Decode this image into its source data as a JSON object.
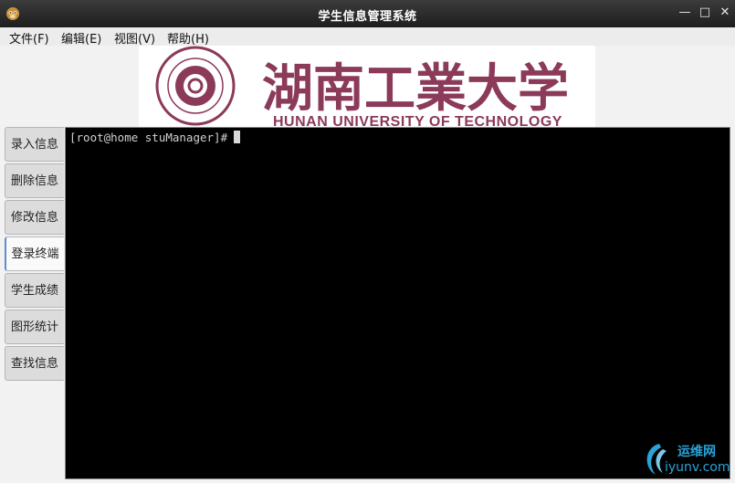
{
  "window": {
    "title": "学生信息管理系统",
    "icon": "monkey-app-icon"
  },
  "window_controls": {
    "minimize": "—",
    "maximize": "□",
    "close": "✕"
  },
  "menu": [
    "文件(F)",
    "编辑(E)",
    "视图(V)",
    "帮助(H)"
  ],
  "logo": {
    "cn": "湖南工業大学",
    "en": "HUNAN UNIVERSITY OF TECHNOLOGY"
  },
  "tabs": [
    {
      "label": "录入信息",
      "active": false
    },
    {
      "label": "删除信息",
      "active": false
    },
    {
      "label": "修改信息",
      "active": false
    },
    {
      "label": "登录终端",
      "active": true
    },
    {
      "label": "学生成绩",
      "active": false
    },
    {
      "label": "图形统计",
      "active": false
    },
    {
      "label": "查找信息",
      "active": false
    }
  ],
  "terminal": {
    "prompt": "[root@home stuManager]#"
  },
  "watermark": {
    "cn": "运维网",
    "en": "iyunv.com"
  },
  "colors": {
    "accent": "#5a8fd0",
    "logo": "#8b3a5a",
    "watermark": "#2aa3d8"
  }
}
